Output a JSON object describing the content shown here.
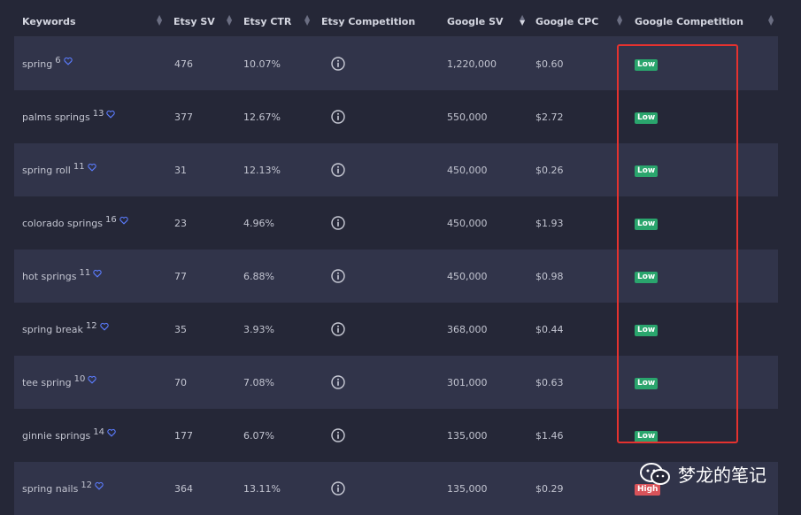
{
  "columns": [
    {
      "key": "keyword",
      "label": "Keywords"
    },
    {
      "key": "etsy_sv",
      "label": "Etsy SV"
    },
    {
      "key": "etsy_ctr",
      "label": "Etsy CTR"
    },
    {
      "key": "etsy_comp",
      "label": "Etsy Competition"
    },
    {
      "key": "google_sv",
      "label": "Google SV"
    },
    {
      "key": "google_cpc",
      "label": "Google CPC"
    },
    {
      "key": "google_comp",
      "label": "Google Competition"
    }
  ],
  "rows": [
    {
      "keyword": "spring",
      "count": "6",
      "etsy_sv": "476",
      "etsy_ctr": "10.07%",
      "google_sv": "1,220,000",
      "google_cpc": "$0.60",
      "google_comp": "Low"
    },
    {
      "keyword": "palms springs",
      "count": "13",
      "etsy_sv": "377",
      "etsy_ctr": "12.67%",
      "google_sv": "550,000",
      "google_cpc": "$2.72",
      "google_comp": "Low"
    },
    {
      "keyword": "spring roll",
      "count": "11",
      "etsy_sv": "31",
      "etsy_ctr": "12.13%",
      "google_sv": "450,000",
      "google_cpc": "$0.26",
      "google_comp": "Low"
    },
    {
      "keyword": "colorado springs",
      "count": "16",
      "etsy_sv": "23",
      "etsy_ctr": "4.96%",
      "google_sv": "450,000",
      "google_cpc": "$1.93",
      "google_comp": "Low"
    },
    {
      "keyword": "hot springs",
      "count": "11",
      "etsy_sv": "77",
      "etsy_ctr": "6.88%",
      "google_sv": "450,000",
      "google_cpc": "$0.98",
      "google_comp": "Low"
    },
    {
      "keyword": "spring break",
      "count": "12",
      "etsy_sv": "35",
      "etsy_ctr": "3.93%",
      "google_sv": "368,000",
      "google_cpc": "$0.44",
      "google_comp": "Low"
    },
    {
      "keyword": "tee spring",
      "count": "10",
      "etsy_sv": "70",
      "etsy_ctr": "7.08%",
      "google_sv": "301,000",
      "google_cpc": "$0.63",
      "google_comp": "Low"
    },
    {
      "keyword": "ginnie springs",
      "count": "14",
      "etsy_sv": "177",
      "etsy_ctr": "6.07%",
      "google_sv": "135,000",
      "google_cpc": "$1.46",
      "google_comp": "Low"
    },
    {
      "keyword": "spring nails",
      "count": "12",
      "etsy_sv": "364",
      "etsy_ctr": "13.11%",
      "google_sv": "135,000",
      "google_cpc": "$0.29",
      "google_comp": "High"
    }
  ],
  "icons": {
    "favorite": "heart-outline-icon",
    "etsy_competition": "info-circle-icon",
    "sort": "sort-arrows-icon"
  },
  "colors": {
    "background": "#252737",
    "row_alt": "#31344a",
    "low_badge": "#2aa56d",
    "high_badge": "#d9535a",
    "highlight_border": "#e5322f",
    "heart": "#5b7cff"
  },
  "watermark": {
    "text": "梦龙的笔记"
  }
}
